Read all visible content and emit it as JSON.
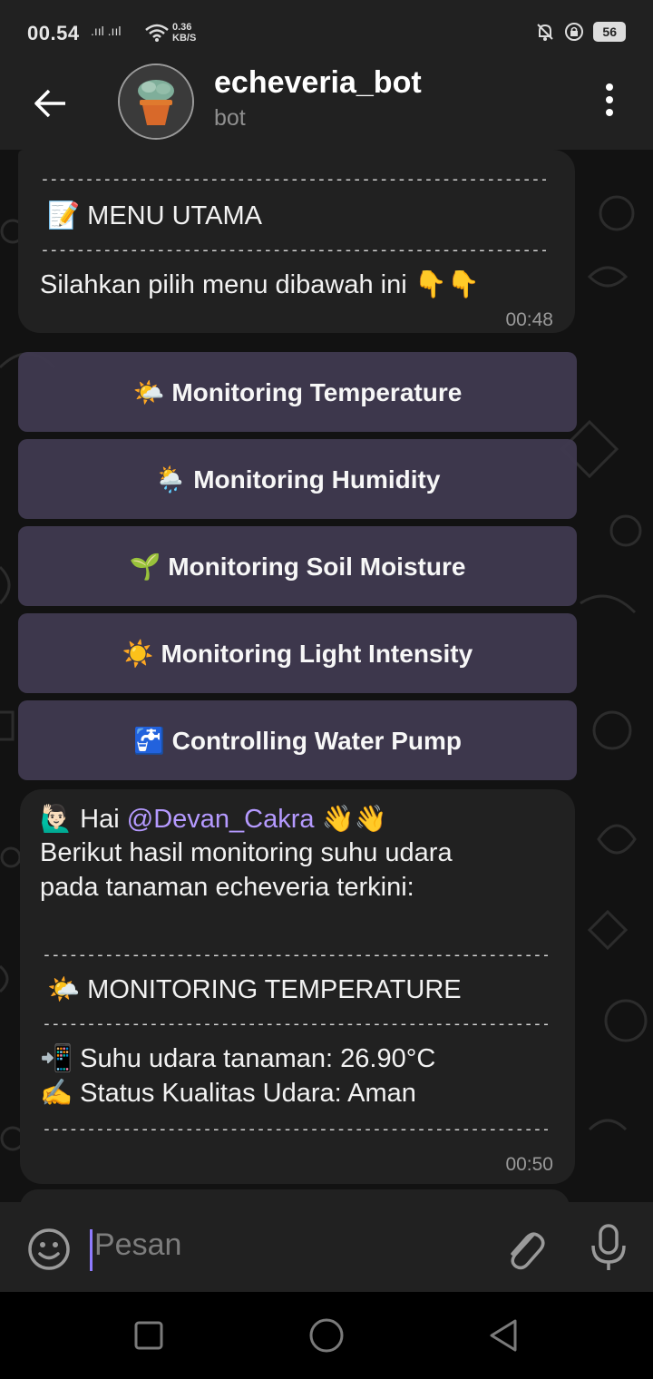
{
  "status_bar": {
    "time": "00.54",
    "signal": ".ııl .ııl",
    "speed_value": "0.36",
    "speed_unit": "KB/S",
    "battery": "56"
  },
  "header": {
    "title": "echeveria_bot",
    "subtitle": "bot"
  },
  "messages": {
    "menu": {
      "divider": "----------------------------------------------------------------------------",
      "heading": "📝 MENU UTAMA",
      "body": "Silahkan pilih menu dibawah ini 👇👇",
      "time": "00:48"
    },
    "monitoring": {
      "greeting_prefix": "🙋🏻‍♂️ Hai ",
      "mention": "@Devan_Cakra",
      "greeting_suffix": " 👋👋",
      "line1": "Berikut hasil monitoring suhu udara",
      "line2": "pada tanaman echeveria terkini:",
      "divider": "----------------------------------------------------------------------------",
      "heading": "🌤️ MONITORING TEMPERATURE",
      "temp": "📲 Suhu udara tanaman: 26.90°C",
      "status": "✍️ Status Kualitas Udara: Aman",
      "time": "00:50"
    }
  },
  "keyboard": [
    "🌤️ Monitoring Temperature",
    "🌦️ Monitoring Humidity",
    "🌱 Monitoring Soil Moisture",
    "☀️ Monitoring Light Intensity",
    "🚰 Controlling Water Pump"
  ],
  "input": {
    "placeholder": "Pesan"
  },
  "colors": {
    "header_bg": "#212121",
    "chat_bg": "#121212",
    "bubble_bg": "#212121",
    "keyboard_bg": "#403950",
    "mention": "#b59aff",
    "cursor": "#8f7bff"
  }
}
